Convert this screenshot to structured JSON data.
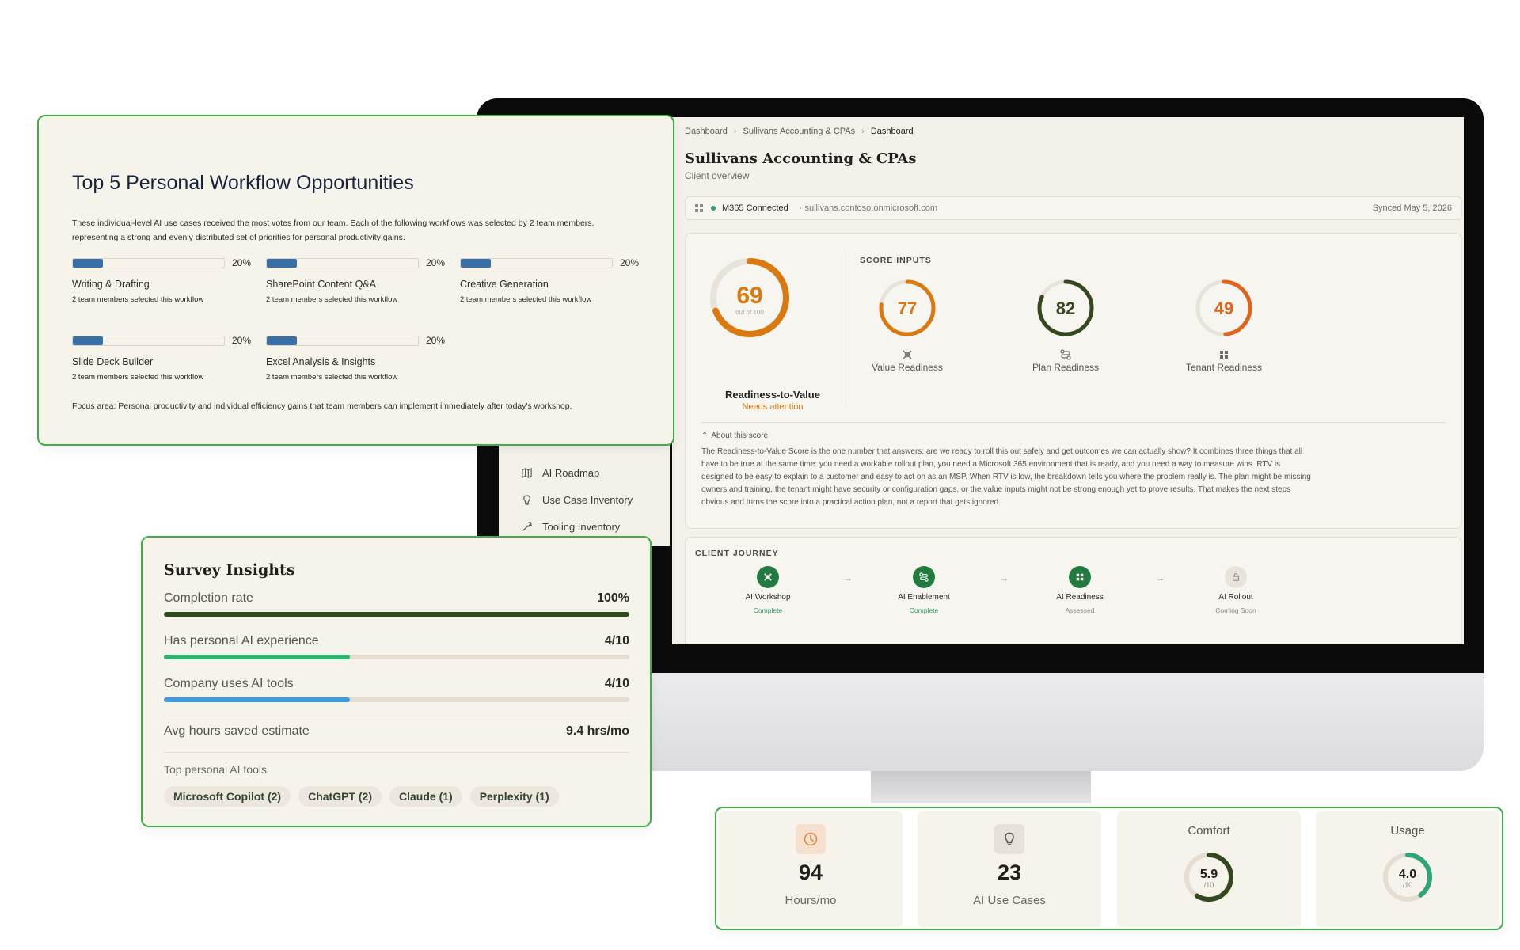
{
  "sidebar": {
    "items": [
      {
        "label": "AI Roadmap",
        "icon": "map-icon"
      },
      {
        "label": "Use Case Inventory",
        "icon": "lightbulb-icon"
      },
      {
        "label": "Tooling Inventory",
        "icon": "wrench-icon"
      }
    ]
  },
  "dashboard": {
    "breadcrumb": [
      "Dashboard",
      "Sullivans Accounting & CPAs",
      "Dashboard"
    ],
    "title": "Sullivans Accounting & CPAs",
    "subtitle": "Client overview",
    "connection": {
      "status": "M365 Connected",
      "domain": "· sullivans.contoso.onmicrosoft.com",
      "synced": "Synced May 5, 2026"
    },
    "readiness": {
      "score": "69",
      "score_value": 69,
      "out_of": "out of 100",
      "label": "Readiness-to-Value",
      "status": "Needs attention",
      "color": "#d9790f"
    },
    "inputs_heading": "SCORE INPUTS",
    "inputs": [
      {
        "value": "77",
        "value_num": 77,
        "label": "Value Readiness",
        "color": "#d9790f",
        "icon": "tools-icon"
      },
      {
        "value": "82",
        "value_num": 82,
        "label": "Plan Readiness",
        "color": "#33481f",
        "icon": "route-icon"
      },
      {
        "value": "49",
        "value_num": 49,
        "label": "Tenant Readiness",
        "color": "#e0641a",
        "icon": "grid-icon"
      }
    ],
    "about_heading": "About this score",
    "about_text": "The Readiness-to-Value Score is the one number that answers: are we ready to roll this out safely and get outcomes we can actually show? It combines three things that all have to be true at the same time: you need a workable rollout plan, you need a Microsoft 365 environment that is ready, and you need a way to measure wins. RTV is designed to be easy to explain to a customer and easy to act on as an MSP. When RTV is low, the breakdown tells you where the problem really is. The plan might be missing owners and training, the tenant might have security or configuration gaps, or the value inputs might not be strong enough yet to prove results. That makes the next steps obvious and turns the score into a practical action plan, not a report that gets ignored.",
    "journey_heading": "CLIENT JOURNEY",
    "journey": [
      {
        "label": "AI Workshop",
        "status": "Complete",
        "status_color": "#2f9e62",
        "done": true,
        "icon": "tools-icon"
      },
      {
        "label": "AI Enablement",
        "status": "Complete",
        "status_color": "#2f9e62",
        "done": true,
        "icon": "route-icon"
      },
      {
        "label": "AI Readiness",
        "status": "Assessed",
        "status_color": "#8a8a82",
        "done": true,
        "icon": "grid-icon"
      },
      {
        "label": "AI Rollout",
        "status": "Coming Soon",
        "status_color": "#8a8a82",
        "done": false,
        "icon": "lock-icon"
      }
    ]
  },
  "workflow": {
    "title": "Top 5 Personal Workflow Opportunities",
    "intro": "These individual-level AI use cases received the most votes from our team. Each of the following workflows was selected by 2 team members, representing a strong and evenly distributed set of priorities for personal productivity gains.",
    "items": [
      {
        "name": "Writing & Drafting",
        "pct": "20%",
        "pct_value": 0.2,
        "count": "2 team members selected this workflow"
      },
      {
        "name": "SharePoint Content Q&A",
        "pct": "20%",
        "pct_value": 0.2,
        "count": "2 team members selected this workflow"
      },
      {
        "name": "Creative Generation",
        "pct": "20%",
        "pct_value": 0.2,
        "count": "2 team members selected this workflow"
      },
      {
        "name": "Slide Deck Builder",
        "pct": "20%",
        "pct_value": 0.2,
        "count": "2 team members selected this workflow"
      },
      {
        "name": "Excel Analysis & Insights",
        "pct": "20%",
        "pct_value": 0.2,
        "count": "2 team members selected this workflow"
      }
    ],
    "focus": "Focus area: Personal productivity and individual efficiency gains that team members can implement immediately after today's workshop."
  },
  "survey": {
    "title": "Survey Insights",
    "rows": [
      {
        "label": "Completion rate",
        "value": "100%",
        "fraction": 1.0,
        "color": "#2f4a1f"
      },
      {
        "label": "Has personal AI experience",
        "value": "4/10",
        "fraction": 0.4,
        "color": "#2fb36f"
      },
      {
        "label": "Company uses AI tools",
        "value": "4/10",
        "fraction": 0.4,
        "color": "#3d9be0"
      }
    ],
    "avg_label": "Avg hours saved estimate",
    "avg_value": "9.4 hrs/mo",
    "tools_label": "Top personal AI tools",
    "tools": [
      "Microsoft Copilot (2)",
      "ChatGPT (2)",
      "Claude (1)",
      "Perplexity (1)"
    ]
  },
  "metrics": {
    "hours": {
      "value": "94",
      "label": "Hours/mo",
      "icon": "clock-icon",
      "icon_color": "#e8853c"
    },
    "use_cases": {
      "value": "23",
      "label": "AI Use Cases",
      "icon": "lightbulb-icon"
    },
    "comfort": {
      "title": "Comfort",
      "value": "5.9",
      "value_num": 5.9,
      "denominator": "/10",
      "color": "#33481f"
    },
    "usage": {
      "title": "Usage",
      "value": "4.0",
      "value_num": 4.0,
      "denominator": "/10",
      "color": "#2fa37a"
    }
  }
}
